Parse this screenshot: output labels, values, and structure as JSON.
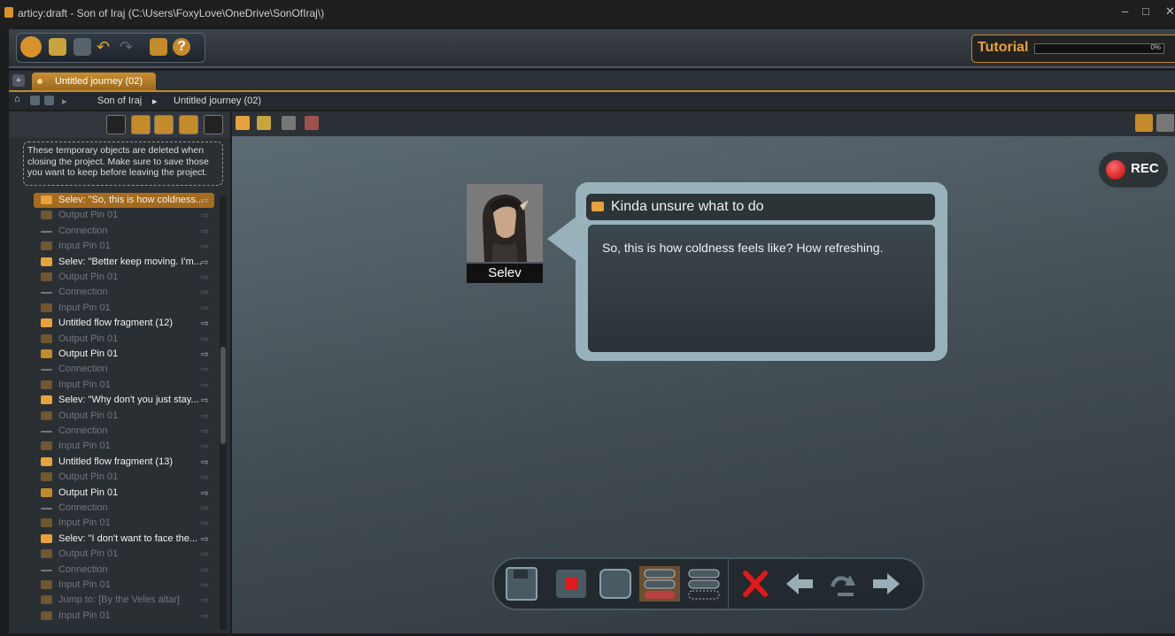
{
  "window": {
    "title": "articy:draft - Son of Iraj (C:\\Users\\FoxyLove\\OneDrive\\SonOfIraj\\)"
  },
  "tutorial": {
    "label": "Tutorial",
    "progress": "0%"
  },
  "tab": {
    "label": "Untitled journey (02)"
  },
  "breadcrumb": {
    "project": "Son of Iraj",
    "current": "Untitled journey (02)"
  },
  "notice": "These temporary objects are deleted when closing the project. Make sure to save those you want to keep before leaving the project.",
  "tree": [
    {
      "label": "Selev: \"So, this is how coldness...",
      "kind": "dialog",
      "dim": false,
      "selected": true
    },
    {
      "label": "Output Pin 01",
      "kind": "outpin",
      "dim": true
    },
    {
      "label": "Connection",
      "kind": "conn",
      "dim": true
    },
    {
      "label": "Input Pin 01",
      "kind": "inpin",
      "dim": true
    },
    {
      "label": "Selev: \"Better keep moving. I'm...",
      "kind": "dialog",
      "dim": false
    },
    {
      "label": "Output Pin 01",
      "kind": "outpin",
      "dim": true
    },
    {
      "label": "Connection",
      "kind": "conn",
      "dim": true
    },
    {
      "label": "Input Pin 01",
      "kind": "inpin",
      "dim": true
    },
    {
      "label": "Untitled flow fragment (12)",
      "kind": "fragment",
      "dim": false
    },
    {
      "label": "Output Pin 01",
      "kind": "outpin",
      "dim": true
    },
    {
      "label": "Output Pin 01",
      "kind": "outpin",
      "dim": false
    },
    {
      "label": "Connection",
      "kind": "conn",
      "dim": true
    },
    {
      "label": "Input Pin 01",
      "kind": "inpin",
      "dim": true
    },
    {
      "label": "Selev: \"Why don't you just stay...",
      "kind": "dialog",
      "dim": false
    },
    {
      "label": "Output Pin 01",
      "kind": "outpin",
      "dim": true
    },
    {
      "label": "Connection",
      "kind": "conn",
      "dim": true
    },
    {
      "label": "Input Pin 01",
      "kind": "inpin",
      "dim": true
    },
    {
      "label": "Untitled flow fragment (13)",
      "kind": "fragment",
      "dim": false
    },
    {
      "label": "Output Pin 01",
      "kind": "outpin",
      "dim": true
    },
    {
      "label": "Output Pin 01",
      "kind": "outpin",
      "dim": false
    },
    {
      "label": "Connection",
      "kind": "conn",
      "dim": true
    },
    {
      "label": "Input Pin 01",
      "kind": "inpin",
      "dim": true
    },
    {
      "label": "Selev: \"I don't want to face the...",
      "kind": "dialog",
      "dim": false
    },
    {
      "label": "Output Pin 01",
      "kind": "outpin",
      "dim": true
    },
    {
      "label": "Connection",
      "kind": "conn",
      "dim": true
    },
    {
      "label": "Input Pin 01",
      "kind": "inpin",
      "dim": true
    },
    {
      "label": "Jump to: [By the Veles altar]",
      "kind": "jump",
      "dim": true
    },
    {
      "label": "Input Pin 01",
      "kind": "inpin",
      "dim": true
    }
  ],
  "rec": {
    "label": "REC",
    "color": "#d00000"
  },
  "speaker": {
    "name": "Selev"
  },
  "menu_text": "Kinda unsure what to do",
  "dialog_text": "So, this is how coldness feels like? How refreshing.",
  "colors": {
    "accent": "#e8a23b",
    "bubble": "#97b2ba"
  }
}
